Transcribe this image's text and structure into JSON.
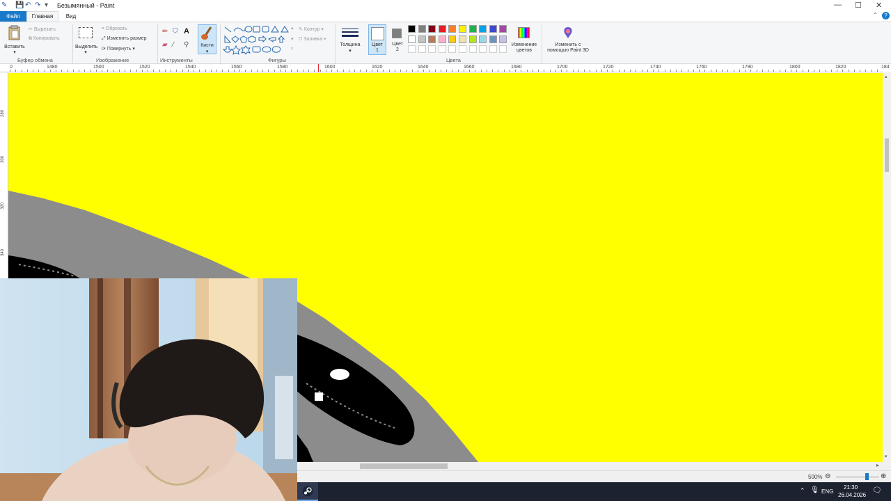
{
  "window": {
    "title": "Безымянный - Paint",
    "controls": {
      "minimize": "—",
      "maximize": "☐",
      "close": "✕"
    }
  },
  "tabs": {
    "file": "Файл",
    "home": "Главная",
    "view": "Вид",
    "help": "?"
  },
  "ribbon": {
    "clipboard": {
      "paste": "Вставить",
      "cut": "Вырезать",
      "copy": "Копировать",
      "group": "Буфер обмена"
    },
    "image": {
      "select": "Выделить",
      "crop": "Обрезать",
      "resize": "Изменить размер",
      "rotate": "Повернуть",
      "group": "Изображение"
    },
    "tools": {
      "group": "Инструменты"
    },
    "brushes": {
      "label": "Кисти"
    },
    "shapes": {
      "outline": "Контур",
      "fill": "Заливка",
      "group": "Фигуры"
    },
    "size": {
      "label": "Толщина"
    },
    "color1": {
      "label": "Цвет",
      "sub": "1"
    },
    "color2": {
      "label": "Цвет",
      "sub": "2"
    },
    "colors_group": "Цвета",
    "edit_colors": {
      "line1": "Изменение",
      "line2": "цветов"
    },
    "paint3d": {
      "line1": "Изменить с",
      "line2": "помощью Paint 3D"
    },
    "palette": [
      "#000000",
      "#7f7f7f",
      "#880015",
      "#ed1c24",
      "#ff7f27",
      "#fff200",
      "#22b14c",
      "#00a2e8",
      "#3f48cc",
      "#a349a4",
      "#ffffff",
      "#c3c3c3",
      "#b97a57",
      "#ffaec9",
      "#ffc90e",
      "#efe4b0",
      "#b5e61d",
      "#99d9ea",
      "#7092be",
      "#c8bfe7"
    ],
    "color2_swatch": "#7f7f7f"
  },
  "ruler": {
    "top": [
      "0",
      "1480",
      "1500",
      "1520",
      "1540",
      "1560",
      "1580",
      "1600",
      "1620",
      "1640",
      "1660",
      "1680",
      "1700",
      "1720",
      "1740",
      "1760",
      "1780",
      "1800",
      "1820",
      "184"
    ],
    "left": [
      "280",
      "300",
      "320",
      "340"
    ]
  },
  "status": {
    "zoom": "500%",
    "minus": "⊖",
    "plus": "⊕"
  },
  "taskbar": {
    "lang": "ENG",
    "time": "21:30",
    "date": "26.04.2026"
  }
}
